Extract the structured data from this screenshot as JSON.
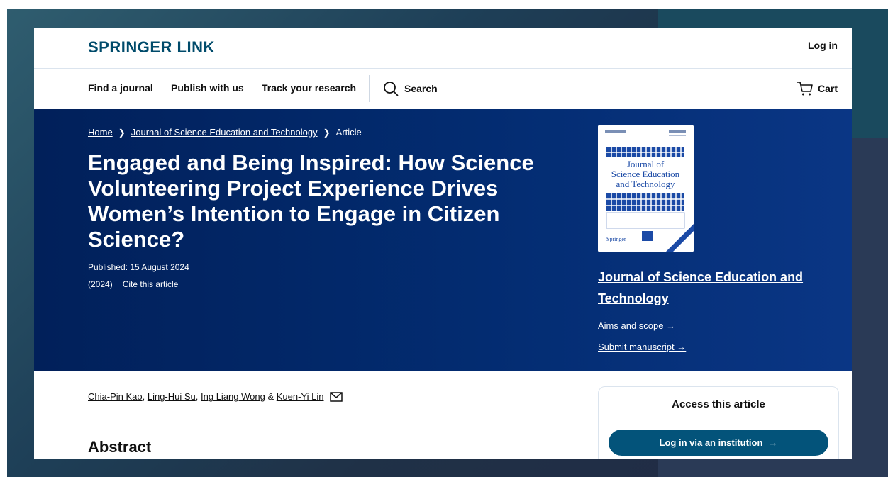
{
  "header": {
    "logo": "SPRINGER LINK",
    "login": "Log in"
  },
  "nav": {
    "find_journal": "Find a journal",
    "publish": "Publish with us",
    "track": "Track your research",
    "search": "Search",
    "cart": "Cart"
  },
  "breadcrumb": {
    "home": "Home",
    "journal": "Journal of Science Education and Technology",
    "current": "Article"
  },
  "article": {
    "title": "Engaged and Being Inspired: How Science Volunteering Project Experience Drives Women’s Intention to Engage in Citizen Science?",
    "published": "Published: 15 August 2024",
    "year": "(2024)",
    "cite": "Cite this article"
  },
  "journal_panel": {
    "cover_line1": "Journal of",
    "cover_line2": "Science Education",
    "cover_line3": "and Technology",
    "cover_publisher": "Springer",
    "journal_name": "Journal of Science Education and Technology",
    "aims": "Aims and scope →",
    "submit": "Submit manuscript →"
  },
  "authors": {
    "a1": "Chia-Pin Kao",
    "a2": "Ling-Hui Su",
    "a3": "Ing Liang Wong",
    "a4": "Kuen-Yi Lin",
    "sep1": ", ",
    "sep2": ", ",
    "amp": " & "
  },
  "abstract_heading": "Abstract",
  "access": {
    "title": "Access this article",
    "button": "Log in via an institution"
  },
  "colors": {
    "brand": "#004b6b",
    "hero": "#032c71",
    "button": "#03537a"
  }
}
